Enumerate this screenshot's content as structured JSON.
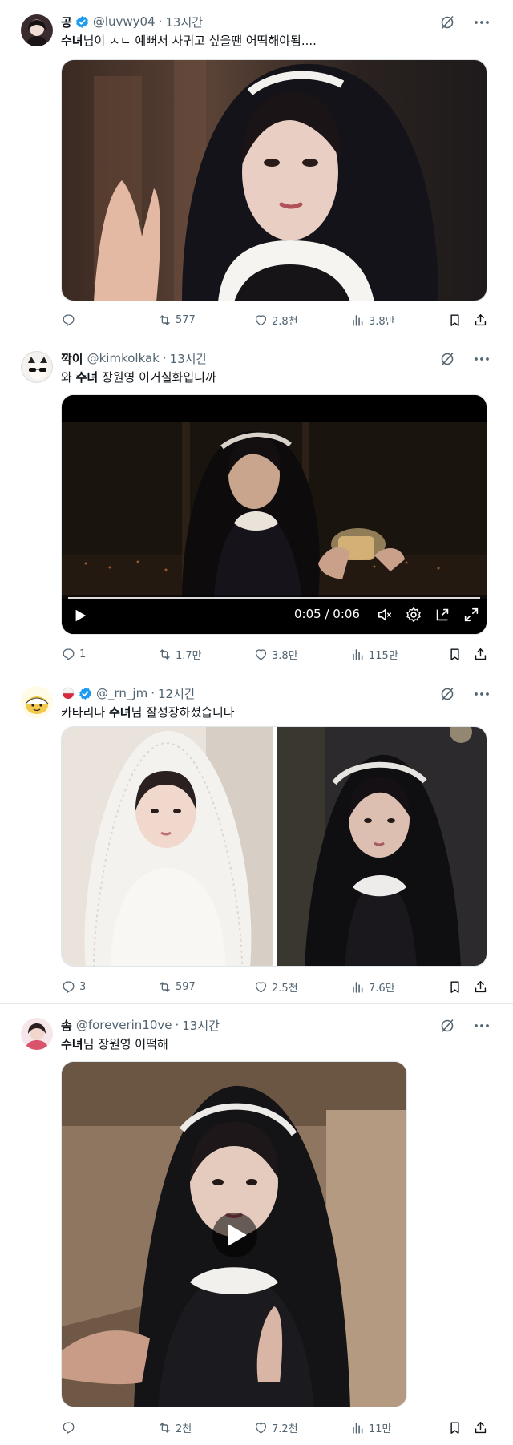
{
  "tweets": [
    {
      "name": "공",
      "handle": "@luvwy04",
      "dot": "·",
      "time": "13시간",
      "text_bold": "수녀",
      "text_rest": "님이 ㅈㄴ 예뻐서 사귀고 싶을땐 어떡해야됨....",
      "replies": "",
      "retweets": "577",
      "likes": "2.8천",
      "views": "3.8만"
    },
    {
      "name": "깍이",
      "handle": "@kimkolkak",
      "dot": "·",
      "time": "13시간",
      "text_pre": "와 ",
      "text_bold": "수녀",
      "text_rest": " 장원영 이거실화입니까",
      "video_time": "0:05 / 0:06",
      "replies": "1",
      "retweets": "1.7만",
      "likes": "3.8만",
      "views": "115만"
    },
    {
      "name": "",
      "handle": "@_rn_jm",
      "dot": "·",
      "time": "12시간",
      "text_pre": "카타리나 ",
      "text_bold": "수녀",
      "text_rest": "님 잘성장하셨습니다",
      "replies": "3",
      "retweets": "597",
      "likes": "2.5천",
      "views": "7.6만"
    },
    {
      "name": "솜",
      "handle": "@foreverin10ve",
      "dot": "·",
      "time": "13시간",
      "text_bold": "수녀",
      "text_rest": "님 장원영 어떡해",
      "replies": "",
      "retweets": "2천",
      "likes": "7.2천",
      "views": "11만"
    }
  ],
  "colors": {
    "text": "#0f1419",
    "secondary": "#536471",
    "verified": "#1d9bf0",
    "divider": "#e6e9eb"
  },
  "icons": [
    "reply-icon",
    "retweet-icon",
    "like-icon",
    "views-icon",
    "bookmark-icon",
    "share-icon",
    "grok-icon",
    "more-icon",
    "verified-badge-icon",
    "play-icon",
    "volume-off-icon",
    "settings-icon",
    "popout-icon",
    "fullscreen-icon"
  ]
}
